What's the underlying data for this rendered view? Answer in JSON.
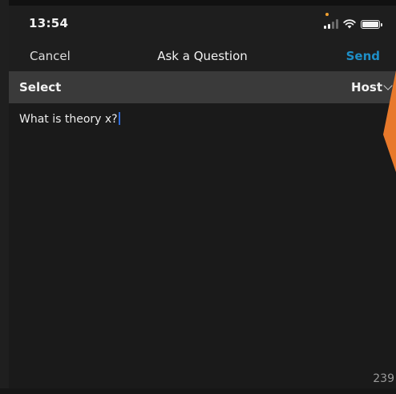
{
  "status_bar": {
    "time": "13:54"
  },
  "nav": {
    "cancel_label": "Cancel",
    "title": "Ask a Question",
    "send_label": "Send"
  },
  "recipient": {
    "select_label": "Select",
    "selected_value": "Host"
  },
  "question": {
    "text": "What is theory x?",
    "char_count": "239"
  },
  "colors": {
    "send_accent": "#1e8fc8",
    "caret": "#2f6bd8",
    "orange_shape": "#e8792b",
    "mic_indicator": "#f0a030"
  }
}
